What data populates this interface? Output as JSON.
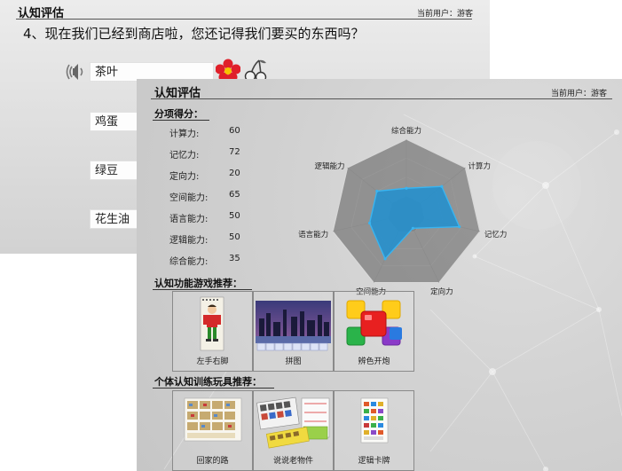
{
  "back_window": {
    "title": "认知评估",
    "user": "当前用户：游客",
    "question": "4、现在我们已经到商店啦，您还记得我们要买的东西吗？",
    "answers": [
      "茶叶",
      "鸡蛋",
      "绿豆",
      "花生油"
    ],
    "hint_icons": [
      "speaker-icon",
      "flower-icon",
      "cherry-icon"
    ]
  },
  "front_window": {
    "title": "认知评估",
    "user": "当前用户：游客",
    "scores_title": "分项得分：",
    "scores": [
      {
        "label": "计算力:",
        "value": "60"
      },
      {
        "label": "记忆力:",
        "value": "72"
      },
      {
        "label": "定向力:",
        "value": "20"
      },
      {
        "label": "空间能力:",
        "value": "65"
      },
      {
        "label": "语言能力:",
        "value": "50"
      },
      {
        "label": "逻辑能力:",
        "value": "50"
      },
      {
        "label": "综合能力:",
        "value": "35"
      }
    ],
    "radar": {
      "axes": [
        "综合能力",
        "计算力",
        "记忆力",
        "定向力",
        "空间能力",
        "语言能力",
        "逻辑能力"
      ],
      "values": [
        35,
        60,
        72,
        20,
        65,
        50,
        50
      ],
      "max": 100,
      "fill_color": "#1f8fd0",
      "stroke_color": "#39b4f0"
    },
    "games_title": "认知功能游戏推荐：",
    "games": [
      {
        "label": "左手右脚",
        "icon": "left-hand-right-foot-image"
      },
      {
        "label": "拼图",
        "icon": "city-skyline-puzzle-image"
      },
      {
        "label": "辨色开炮",
        "icon": "color-blocks-image"
      }
    ],
    "toys_title": "个体认知训练玩具推荐：",
    "toys": [
      {
        "label": "回家的路",
        "icon": "way-home-cards-image"
      },
      {
        "label": "说说老物件",
        "icon": "old-objects-cards-image"
      },
      {
        "label": "逻辑卡牌",
        "icon": "logic-card-image"
      }
    ]
  }
}
